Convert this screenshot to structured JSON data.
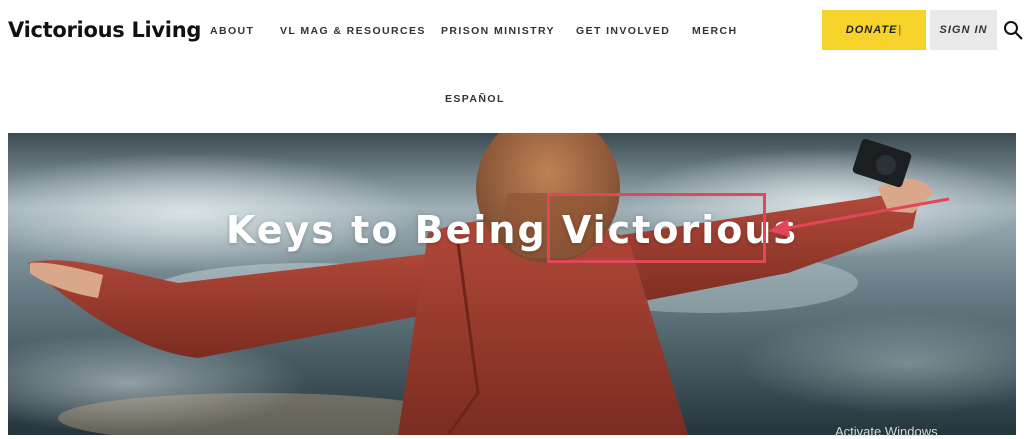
{
  "header": {
    "brand": "Victorious Living",
    "nav": [
      "ABOUT",
      "VL MAG & RESOURCES",
      "PRISON MINISTRY",
      "GET INVOLVED",
      "MERCH"
    ],
    "nav_second_row": "ESPAÑOL",
    "donate_label": "DONATE",
    "signin_label": "SIGN IN",
    "search_icon": "search-icon"
  },
  "hero": {
    "title": "Keys to Being Victorious",
    "highlighted_word": "Victorious"
  },
  "overlay": {
    "os_watermark": "Activate Windows"
  },
  "colors": {
    "donate_bg": "#f6d32a",
    "signin_bg": "#e9e9e9",
    "annotation": "#e0475a",
    "jacket": "#9b3b2c"
  }
}
